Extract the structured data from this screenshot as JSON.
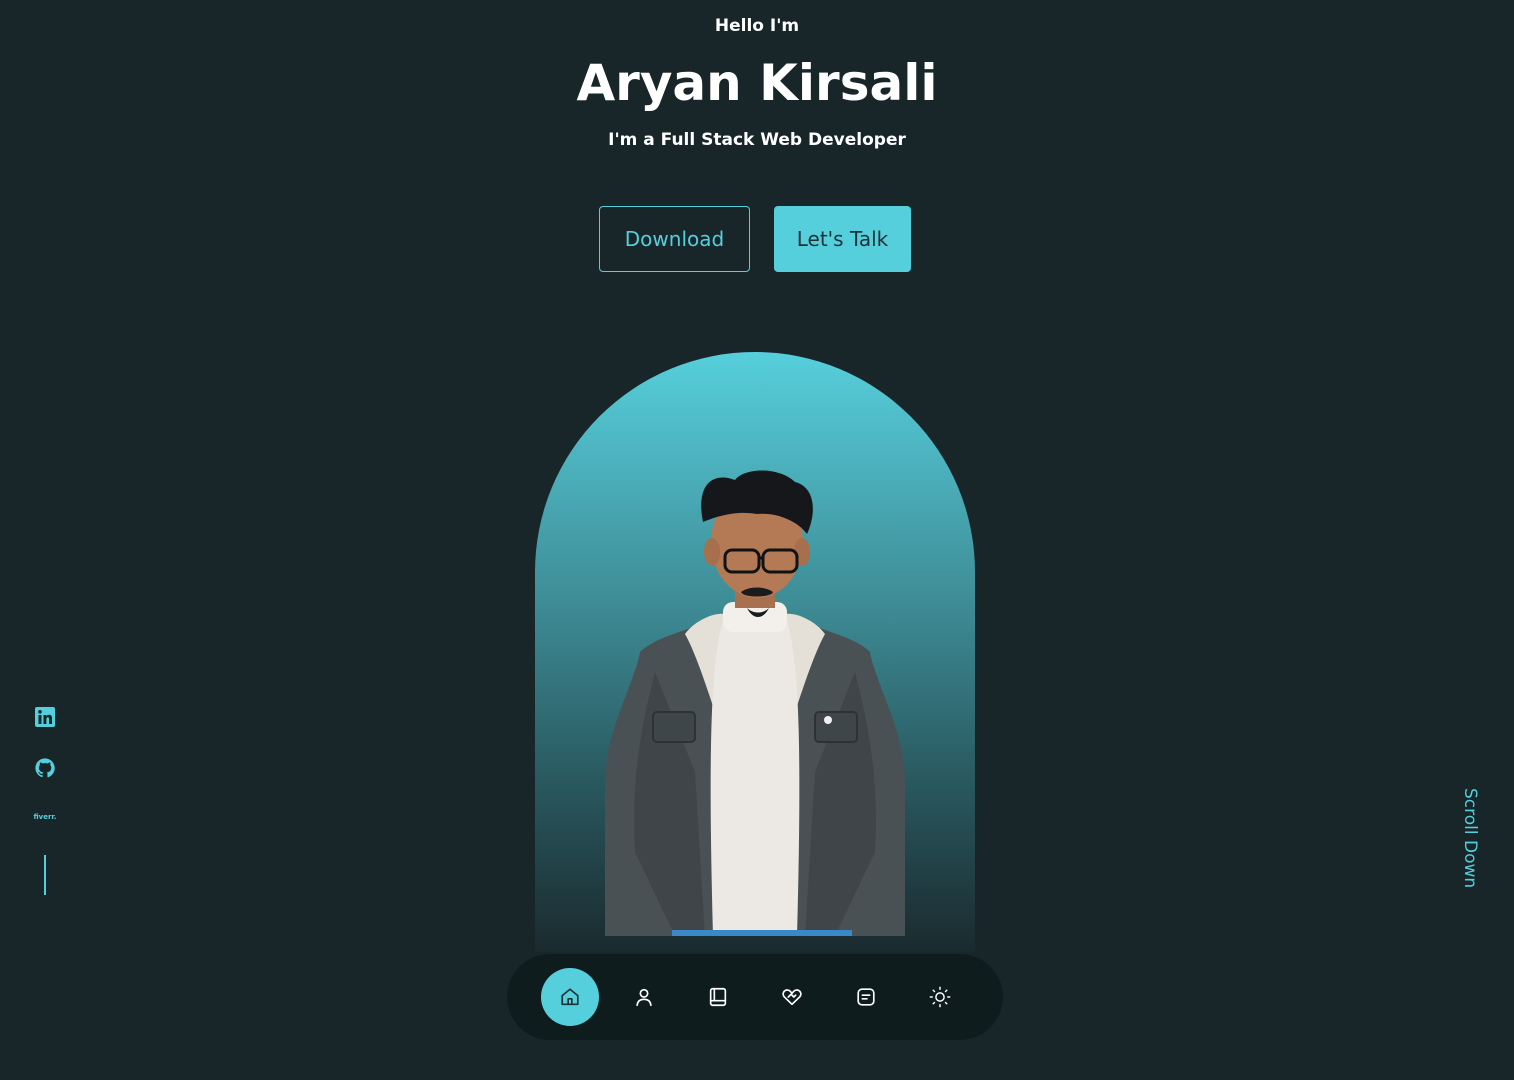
{
  "hero": {
    "greeting": "Hello I'm",
    "name": "Aryan Kirsali",
    "role": "I'm a Full Stack Web Developer"
  },
  "buttons": {
    "download_label": "Download",
    "talk_label": "Let's Talk"
  },
  "social": {
    "fiverr_label": "fiverr.",
    "items": [
      "linkedin-icon",
      "github-icon",
      "fiverr-logo"
    ]
  },
  "scroll": {
    "label": "Scroll Down"
  },
  "nav": {
    "active": "home",
    "items": [
      "home-icon",
      "user-icon",
      "book-icon",
      "handshake-icon",
      "message-icon",
      "sun-icon"
    ]
  },
  "colors": {
    "background": "#18262a",
    "accent": "#55cfdc",
    "nav_background": "#0f1c1e",
    "text": "#ffffff"
  }
}
